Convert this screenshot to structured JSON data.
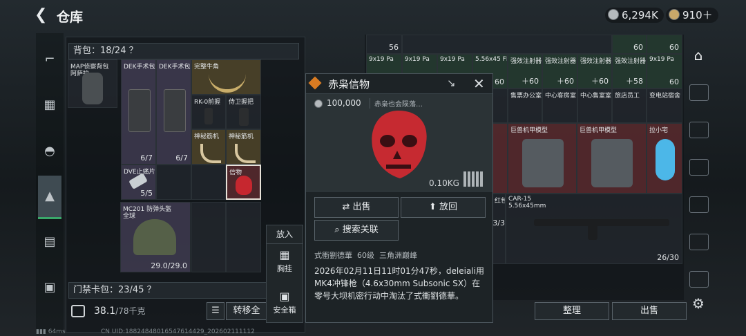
{
  "header": {
    "title": "仓库",
    "currency1": "6,294K",
    "currency2": "910＋"
  },
  "left": {
    "backpack_label": "背包：18/24 ？",
    "backpack_item": "MAP侦察背包",
    "backpack_item_sub": "阿萨拉",
    "items": [
      {
        "name": "DEK手术包",
        "count": "6/7"
      },
      {
        "name": "DEK手术包",
        "count": "6/7"
      },
      {
        "name": "完整牛角",
        "count": ""
      },
      {
        "name": "RK-0前握",
        "count": ""
      },
      {
        "name": "侍卫握把",
        "count": ""
      },
      {
        "name": "神秘筋机",
        "count": ""
      },
      {
        "name": "神秘筋机",
        "count": ""
      },
      {
        "name": "DVE止痛片",
        "count": "5/5"
      },
      {
        "name": "信物",
        "count": ""
      }
    ],
    "helmet_name": "MC201 防弹头盔",
    "helmet_sub": "全球",
    "helmet_dur": "29.0/29.0",
    "keycard_label": "门禁卡包：23/45 ？",
    "weight": "38.1",
    "weight_max": "/78千克",
    "transfer_btn": "转移全"
  },
  "chest": {
    "header": "放入",
    "chest_rig": "胸挂",
    "safe_box": "安全箱"
  },
  "popup": {
    "title": "赤枭信物",
    "price": "100,000",
    "desc_short": "赤枭也会陨落…",
    "weight": "0.10KG",
    "sell": "出售",
    "put_back": "放回",
    "search": "搜索关联",
    "owner": "式衝劉德華",
    "level": "60级",
    "rank": "三角洲巅峰",
    "story": "2026年02月11日11时01分47秒，deleiali用MK4冲锋枪（4.6x30mm Subsonic SX）在零号大坝机密行动中淘汰了式衝劉德華。"
  },
  "right": {
    "row_top_counts": [
      "56",
      "60",
      "60"
    ],
    "ammo": [
      {
        "name": "9x19 Pa",
        "count": ""
      },
      {
        "name": "9x19 Pa",
        "count": ""
      },
      {
        "name": "9x19 Pa",
        "count": ""
      },
      {
        "name": "5.56x45 FM",
        "count": "60"
      },
      {
        "name": "强效注射器",
        "count": "＋60"
      },
      {
        "name": "强效注射器",
        "count": "＋60"
      },
      {
        "name": "强效注射器",
        "count": "＋60"
      },
      {
        "name": "强效注射器",
        "count": "＋58"
      },
      {
        "name": "9x19 Pa",
        "count": "60"
      }
    ],
    "keys": [
      "售票办公室",
      "中心客房室",
      "中心售室室",
      "旅店员工",
      "变电站宿舍"
    ],
    "models": [
      "巨兽机甲模型",
      "巨兽机甲模型"
    ],
    "doll": "拉小宅",
    "red_pack": "红包",
    "red_pack_count": "3/3",
    "gun_name": "CAR-15",
    "gun_ammo": "5.56x45mm",
    "gun_count": "26/30",
    "sort_btn": "整理",
    "sell_btn": "出售"
  },
  "footer": {
    "ping": "64ms",
    "uid": "CN UID:18824848016547614429_202602111112"
  }
}
